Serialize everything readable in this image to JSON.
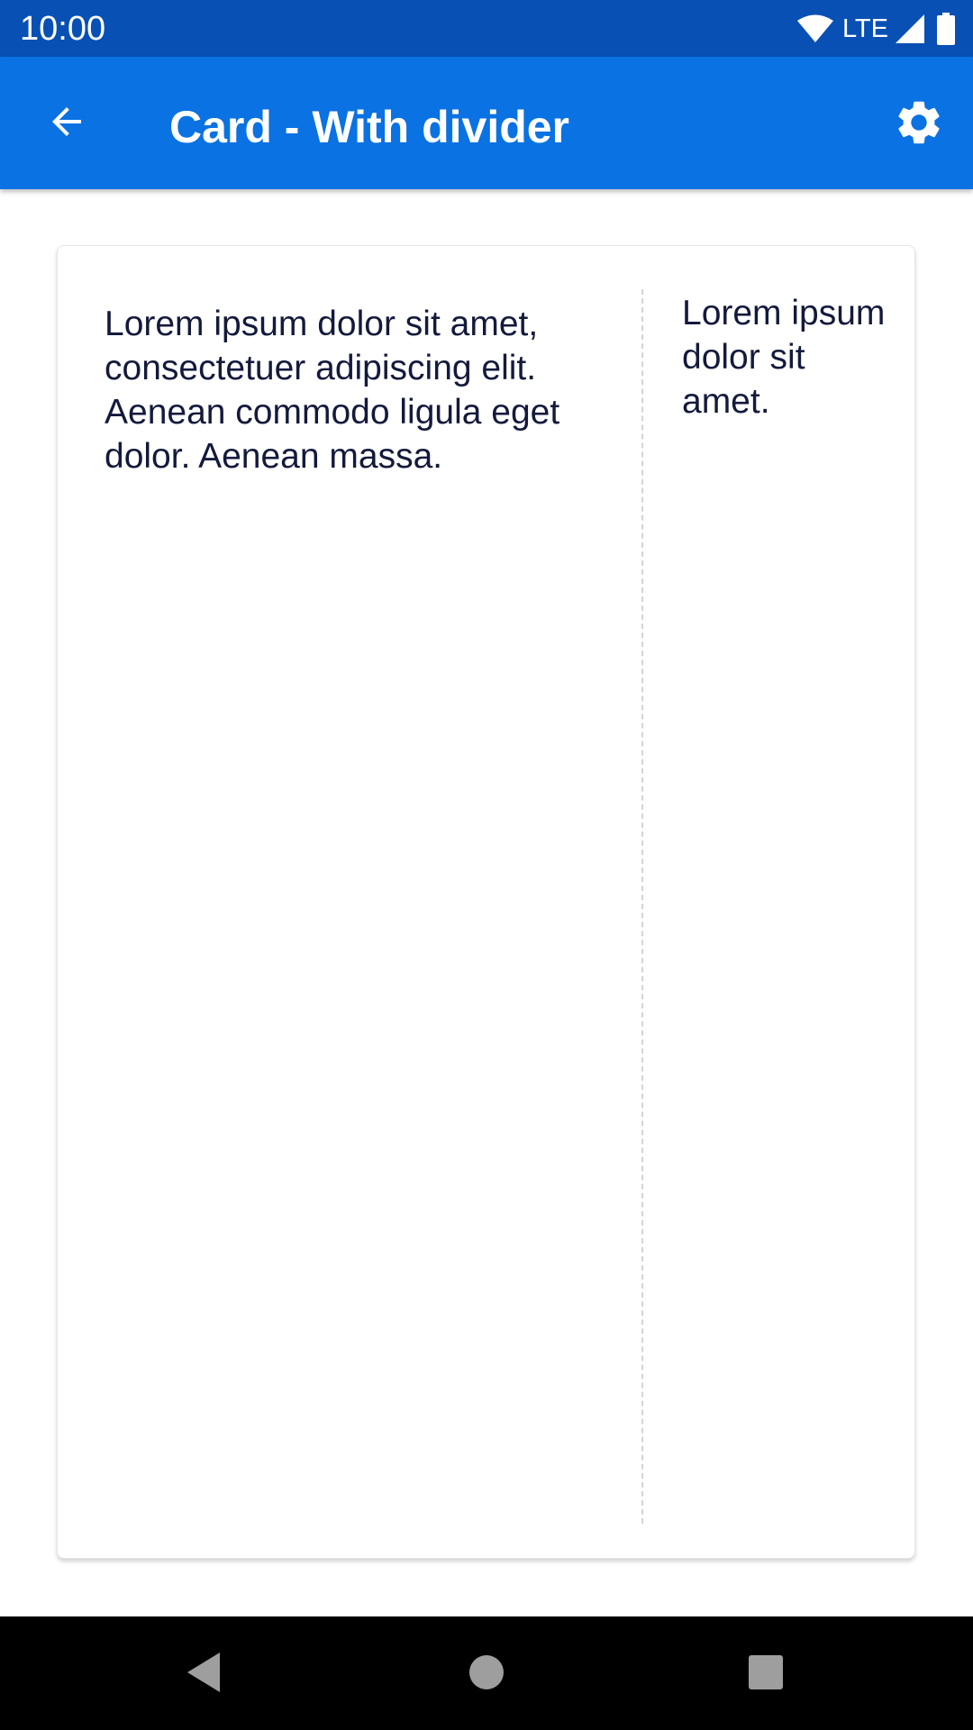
{
  "status_bar": {
    "time": "10:00",
    "network_label": "LTE",
    "icons": [
      "wifi-icon",
      "signal-icon",
      "battery-icon"
    ]
  },
  "app_bar": {
    "title": "Card - With divider",
    "back_icon": "arrow-back-icon",
    "settings_icon": "gear-icon"
  },
  "card": {
    "left_text": "Lorem ipsum dolor sit amet, consectetuer adipiscing elit. Aenean commodo ligula eget dolor. Aenean massa.",
    "right_text": "Lorem ipsum dolor sit amet."
  },
  "nav_bar": {
    "icons": [
      "nav-back-icon",
      "nav-home-icon",
      "nav-recents-icon"
    ]
  },
  "colors": {
    "status_bar": "#0850b4",
    "app_bar": "#0a72e2",
    "card_text": "#141a3c",
    "divider": "#d4d4d4",
    "nav_bar": "#000000"
  }
}
